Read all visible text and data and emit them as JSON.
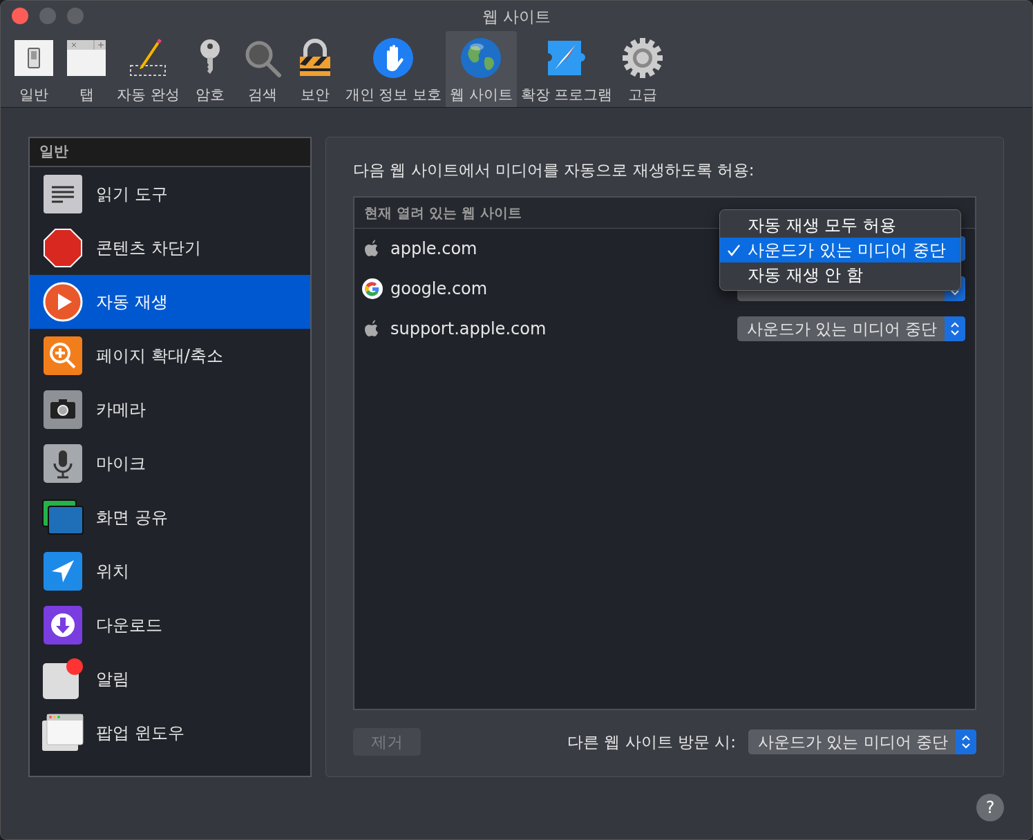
{
  "window": {
    "title": "웹 사이트"
  },
  "toolbar": [
    {
      "label": "일반",
      "selected": false
    },
    {
      "label": "탭",
      "selected": false
    },
    {
      "label": "자동 완성",
      "selected": false
    },
    {
      "label": "암호",
      "selected": false
    },
    {
      "label": "검색",
      "selected": false
    },
    {
      "label": "보안",
      "selected": false
    },
    {
      "label": "개인 정보 보호",
      "selected": false
    },
    {
      "label": "웹 사이트",
      "selected": true
    },
    {
      "label": "확장 프로그램",
      "selected": false
    },
    {
      "label": "고급",
      "selected": false
    }
  ],
  "sidebar": {
    "header": "일반",
    "items": [
      {
        "label": "읽기 도구",
        "selected": false
      },
      {
        "label": "콘텐츠 차단기",
        "selected": false
      },
      {
        "label": "자동 재생",
        "selected": true
      },
      {
        "label": "페이지 확대/축소",
        "selected": false
      },
      {
        "label": "카메라",
        "selected": false
      },
      {
        "label": "마이크",
        "selected": false
      },
      {
        "label": "화면 공유",
        "selected": false
      },
      {
        "label": "위치",
        "selected": false
      },
      {
        "label": "다운로드",
        "selected": false
      },
      {
        "label": "알림",
        "selected": false
      },
      {
        "label": "팝업 윈도우",
        "selected": false
      }
    ]
  },
  "panel": {
    "heading": "다음 웹 사이트에서 미디어를 자동으로 재생하도록 허용:",
    "table": {
      "header": "현재 열려 있는 웹 사이트",
      "rows": [
        {
          "site": "apple.com",
          "popup": {}
        },
        {
          "site": "google.com",
          "popup": {}
        },
        {
          "site": "support.apple.com",
          "popup": {
            "value": "사운드가 있는 미디어 중단"
          }
        }
      ]
    },
    "menu": {
      "options": [
        {
          "label": "자동 재생 모두 허용",
          "selected": false
        },
        {
          "label": "사운드가 있는 미디어 중단",
          "selected": true
        },
        {
          "label": "자동 재생 안 함",
          "selected": false
        }
      ]
    },
    "remove_button": {
      "label": "제거",
      "disabled": true
    },
    "other_sites": {
      "label": "다른 웹 사이트 방문 시:",
      "value": "사운드가 있는 미디어 중단"
    }
  },
  "help_button": {
    "label": "?"
  }
}
